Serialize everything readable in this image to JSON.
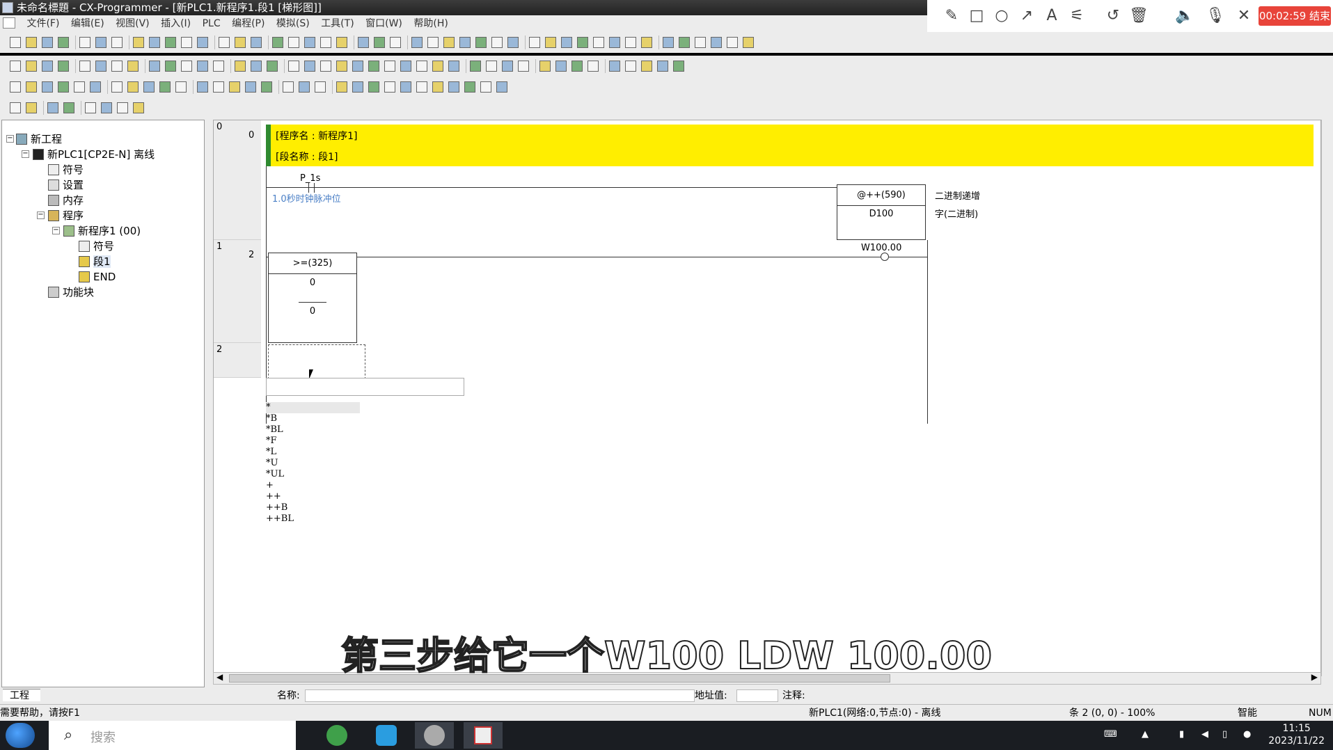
{
  "window": {
    "title": "未命名標題 - CX-Programmer - [新PLC1.新程序1.段1 [梯形图]]"
  },
  "recorder": {
    "timer": "00:02:59 结束"
  },
  "menu": [
    "文件(F)",
    "编辑(E)",
    "视图(V)",
    "插入(I)",
    "PLC",
    "编程(P)",
    "模拟(S)",
    "工具(T)",
    "窗口(W)",
    "帮助(H)"
  ],
  "tree": {
    "root": "新工程",
    "plc": "新PLC1[CP2E-N] 离线",
    "symbols": "符号",
    "settings": "设置",
    "memory": "内存",
    "programs": "程序",
    "program1": "新程序1 (00)",
    "p_symbols": "符号",
    "section1": "段1",
    "end": "END",
    "function_blocks": "功能块",
    "tab": "工程"
  },
  "ladder": {
    "header_program": "[程序名 : 新程序1]",
    "header_section": "[段名称 : 段1]",
    "rungs": [
      {
        "rung": "0",
        "step": "0"
      },
      {
        "rung": "1",
        "step": "2"
      },
      {
        "rung": "2",
        "step": ""
      }
    ],
    "contact_name": "P_1s",
    "contact_comment": "1.0秒时钟脉冲位",
    "instr1_name": "@++(590)",
    "instr1_operand": "D100",
    "instr1_comment_line1": "二进制递增",
    "instr1_comment_line2": "字(二进制)",
    "compare_name": ">=(325)",
    "compare_op1": "0",
    "compare_op2": "0",
    "coil_addr": "W100.00",
    "completion_list": [
      "*",
      "*B",
      "*BL",
      "*F",
      "*L",
      "*U",
      "*UL",
      "+",
      "++",
      "++B",
      "++BL"
    ]
  },
  "namebar": {
    "name_label": "名称:",
    "addr_label": "地址值:",
    "comment_label": "注释:"
  },
  "status": {
    "help": "需要帮助，请按F1",
    "plc": "新PLC1(网络:0,节点:0) - 离线",
    "pos": "条 2 (0, 0) - 100%",
    "mode": "智能",
    "num": "NUM"
  },
  "taskbar": {
    "search_placeholder": "搜索",
    "time": "11:15",
    "date": "2023/11/22"
  },
  "subtitle": "第三步给它一个W100  LDW 100.00"
}
